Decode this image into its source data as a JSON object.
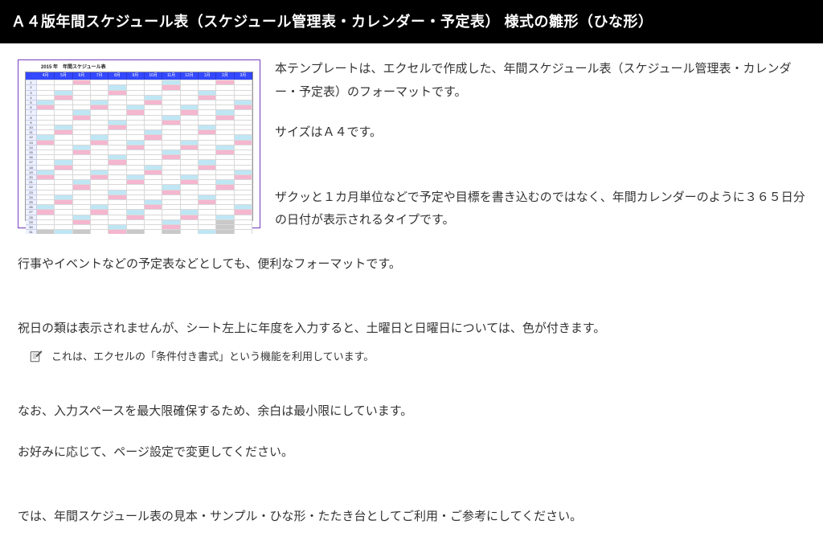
{
  "header": {
    "title": "Ａ４版年間スケジュール表（スケジュール管理表・カレンダー・予定表） 様式の雛形（ひな形）"
  },
  "thumbnail": {
    "caption": "2015 年　年間スケジュール表",
    "months": [
      "4月",
      "5月",
      "6月",
      "7月",
      "8月",
      "9月",
      "10月",
      "11月",
      "12月",
      "1月",
      "2月",
      "3月"
    ]
  },
  "paragraphs": {
    "p1": "本テンプレートは、エクセルで作成した、年間スケジュール表（スケジュール管理表・カレンダー・予定表）のフォーマットです。",
    "p2": "サイズはＡ４です。",
    "p3": "ザクッと１カ月単位などで予定や目標を書き込むのではなく、年間カレンダーのように３６５日分の日付が表示されるタイプです。",
    "p4": "行事やイベントなどの予定表などとしても、便利なフォーマットです。",
    "p5": "祝日の類は表示されませんが、シート左上に年度を入力すると、土曜日と日曜日については、色が付きます。",
    "note1": "これは、エクセルの「条件付き書式」という機能を利用しています。",
    "p6": "なお、入力スペースを最大限確保するため、余白は最小限にしています。",
    "p7": "お好みに応じて、ページ設定で変更してください。",
    "p8": "では、年間スケジュール表の見本・サンプル・ひな形・たたき台としてご利用・ご参考にしてください。"
  }
}
